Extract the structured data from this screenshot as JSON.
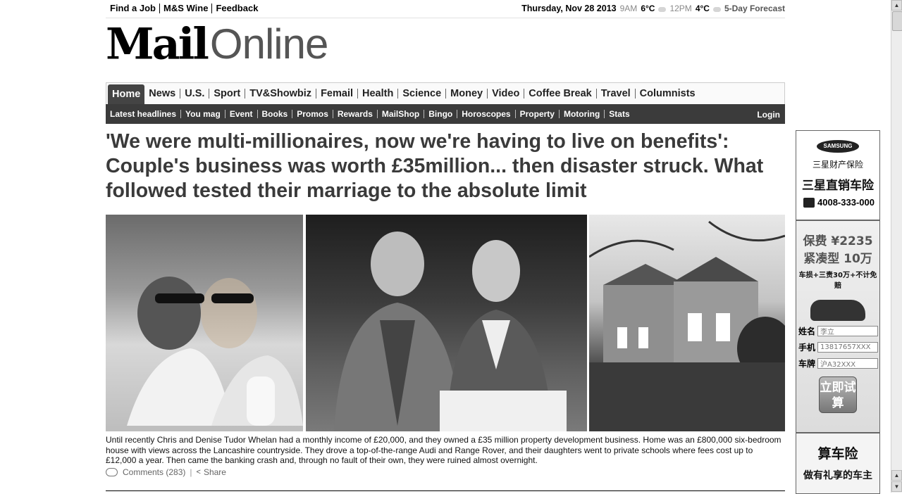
{
  "topbar": {
    "links": [
      "Find a Job",
      "M&S Wine",
      "Feedback"
    ],
    "date": "Thursday, Nov 28 2013",
    "time1": "9AM",
    "temp1": "6°C",
    "time2": "12PM",
    "temp2": "4°C",
    "forecast": "5-Day Forecast"
  },
  "logo": {
    "mail": "Mail",
    "online": "Online"
  },
  "nav": {
    "items": [
      "Home",
      "News",
      "U.S.",
      "Sport",
      "TV&Showbiz",
      "Femail",
      "Health",
      "Science",
      "Money",
      "Video",
      "Coffee Break",
      "Travel",
      "Columnists"
    ],
    "active": "Home"
  },
  "subnav": {
    "items": [
      "Latest headlines",
      "You mag",
      "Event",
      "Books",
      "Promos",
      "Rewards",
      "MailShop",
      "Bingo",
      "Horoscopes",
      "Property",
      "Motoring",
      "Stats"
    ],
    "login": "Login"
  },
  "article": {
    "headline": "'We were multi-millionaires, now we're having to live on benefits': Couple's business was worth £35million... then disaster struck. What followed tested their marriage to the absolute limit",
    "caption": "Until recently Chris and Denise Tudor Whelan had a monthly income of £20,000, and they owned a £35 million property development business. Home was an £800,000 six-bedroom house with views across the Lancashire countryside. They drove a top-of-the-range Audi and Range Rover, and their daughters went to private schools where fees cost up to £12,000 a year. Then came the banking crash and, through no fault of their own, they were ruined almost overnight.",
    "comments": "Comments (283)",
    "share": "Share"
  },
  "ad": {
    "brand": "SAMSUNG",
    "line1": "三星财产保险",
    "line2": "三星直销车险",
    "phone": "4008-333-000",
    "promo1": "保费 ¥2235",
    "promo2": "紧凑型 10万",
    "promo3": "车损+三责30万+不计免赔",
    "form": {
      "name_label": "姓名",
      "name_value": "李立",
      "phone_label": "手机",
      "phone_value": "13817657XXX",
      "plate_label": "车牌",
      "plate_value": "沪A32XXX"
    },
    "button": "立即试算",
    "bottom1": "算车险",
    "bottom2": "做有礼享的车主"
  }
}
